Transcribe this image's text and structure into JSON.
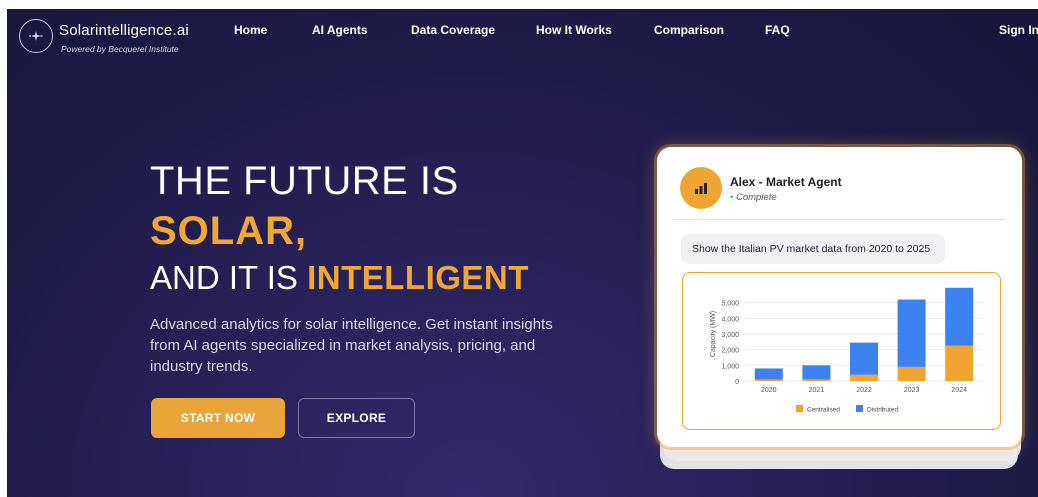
{
  "brand": {
    "name": "Solarintelligence.ai",
    "tagline": "Powered by Becquerel Institute",
    "logo_icon": "solar-sparkle-icon"
  },
  "nav": {
    "links": [
      "Home",
      "AI Agents",
      "Data Coverage",
      "How It Works",
      "Comparison",
      "FAQ"
    ],
    "sign_in": "Sign In"
  },
  "hero": {
    "line1": "THE FUTURE IS",
    "line2": "SOLAR,",
    "line3_prefix": "AND IT IS",
    "line3_accent": "INTELLIGENT",
    "description": "Advanced analytics for solar intelligence. Get instant insights from AI agents specialized in market analysis, pricing, and industry trends.",
    "start_button": "START NOW",
    "explore_button": "EXPLORE"
  },
  "agent_card": {
    "agent_name": "Alex - Market Agent",
    "status_dot": "•",
    "status": "Complete",
    "query": "Show the Italian PV market data from 2020 to 2025",
    "avatar_icon": "bar-chart-icon"
  },
  "colors": {
    "accent": "#f3a733",
    "background": "#1f1b4a",
    "centralised": "#f0a532",
    "distributed": "#3b82f0"
  },
  "chart_data": {
    "type": "bar",
    "stacked": true,
    "categories": [
      "2020",
      "2021",
      "2022",
      "2023",
      "2024"
    ],
    "series": [
      {
        "name": "Centralised",
        "values": [
          100,
          100,
          400,
          900,
          2250
        ]
      },
      {
        "name": "Distributed",
        "values": [
          700,
          900,
          2050,
          4300,
          3700
        ]
      }
    ],
    "ylabel": "Capacity (MW)",
    "xlabel": "",
    "ylim": [
      0,
      6000
    ],
    "yticks": [
      "0",
      "1,000",
      "2,000",
      "3,000",
      "4,000",
      "5,000"
    ],
    "legend_position": "bottom",
    "grid": true
  }
}
